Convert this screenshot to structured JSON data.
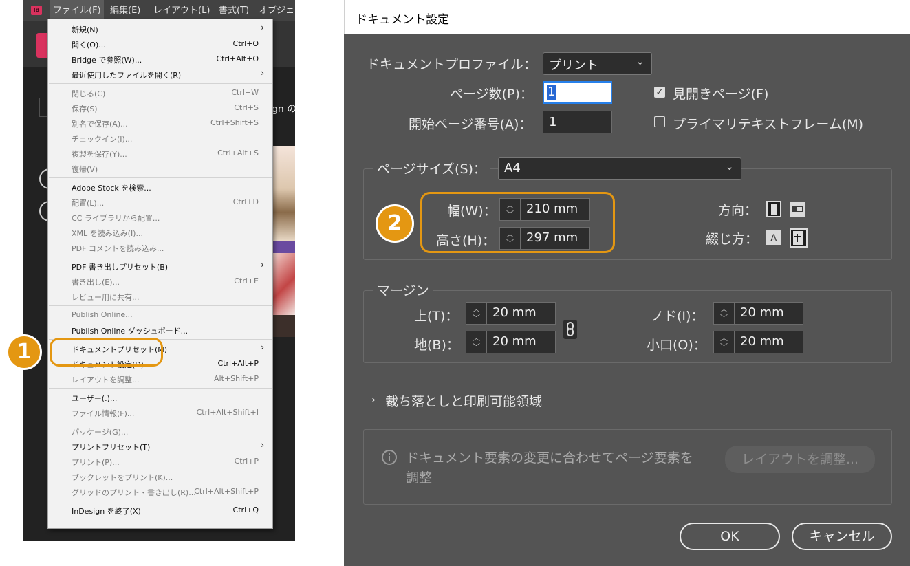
{
  "app": {
    "logo_text": "Id",
    "menubar": [
      "ファイル(F)",
      "編集(E)",
      "レイアウト(L)",
      "書式(T)",
      "オブジェ"
    ],
    "partial_text": "gn の"
  },
  "file_menu": {
    "items": [
      {
        "label": "新規(N)",
        "shortcut": "",
        "submenu": true,
        "disabled": false
      },
      {
        "label": "開く(O)...",
        "shortcut": "Ctrl+O",
        "submenu": false,
        "disabled": false
      },
      {
        "label": "Bridge で参照(W)...",
        "shortcut": "Ctrl+Alt+O",
        "submenu": false,
        "disabled": false
      },
      {
        "label": "最近使用したファイルを開く(R)",
        "shortcut": "",
        "submenu": true,
        "disabled": false
      },
      {
        "label": "閉じる(C)",
        "shortcut": "Ctrl+W",
        "submenu": false,
        "disabled": true
      },
      {
        "label": "保存(S)",
        "shortcut": "Ctrl+S",
        "submenu": false,
        "disabled": true
      },
      {
        "label": "別名で保存(A)...",
        "shortcut": "Ctrl+Shift+S",
        "submenu": false,
        "disabled": true
      },
      {
        "label": "チェックイン(I)...",
        "shortcut": "",
        "submenu": false,
        "disabled": true
      },
      {
        "label": "複製を保存(Y)...",
        "shortcut": "Ctrl+Alt+S",
        "submenu": false,
        "disabled": true
      },
      {
        "label": "復帰(V)",
        "shortcut": "",
        "submenu": false,
        "disabled": true
      },
      {
        "label": "Adobe Stock を検索...",
        "shortcut": "",
        "submenu": false,
        "disabled": false
      },
      {
        "label": "配置(L)...",
        "shortcut": "Ctrl+D",
        "submenu": false,
        "disabled": true
      },
      {
        "label": "CC ライブラリから配置...",
        "shortcut": "",
        "submenu": false,
        "disabled": true
      },
      {
        "label": "XML を読み込み(I)...",
        "shortcut": "",
        "submenu": false,
        "disabled": true
      },
      {
        "label": "PDF コメントを読み込み...",
        "shortcut": "",
        "submenu": false,
        "disabled": true
      },
      {
        "label": "PDF 書き出しプリセット(B)",
        "shortcut": "",
        "submenu": true,
        "disabled": false
      },
      {
        "label": "書き出し(E)...",
        "shortcut": "Ctrl+E",
        "submenu": false,
        "disabled": true
      },
      {
        "label": "レビュー用に共有...",
        "shortcut": "",
        "submenu": false,
        "disabled": true
      },
      {
        "label": "Publish Online...",
        "shortcut": "",
        "submenu": false,
        "disabled": true
      },
      {
        "label": "Publish Online ダッシュボード...",
        "shortcut": "",
        "submenu": false,
        "disabled": false
      },
      {
        "label": "ドキュメントプリセット(M)",
        "shortcut": "",
        "submenu": true,
        "disabled": false
      },
      {
        "label": "ドキュメント設定(D)...",
        "shortcut": "Ctrl+Alt+P",
        "submenu": false,
        "disabled": false
      },
      {
        "label": "レイアウトを調整...",
        "shortcut": "Alt+Shift+P",
        "submenu": false,
        "disabled": true
      },
      {
        "label": "ユーザー(.)...",
        "shortcut": "",
        "submenu": false,
        "disabled": false
      },
      {
        "label": "ファイル情報(F)...",
        "shortcut": "Ctrl+Alt+Shift+I",
        "submenu": false,
        "disabled": true
      },
      {
        "label": "パッケージ(G)...",
        "shortcut": "",
        "submenu": false,
        "disabled": true
      },
      {
        "label": "プリントプリセット(T)",
        "shortcut": "",
        "submenu": true,
        "disabled": false
      },
      {
        "label": "プリント(P)...",
        "shortcut": "Ctrl+P",
        "submenu": false,
        "disabled": true
      },
      {
        "label": "ブックレットをプリント(K)...",
        "shortcut": "",
        "submenu": false,
        "disabled": true
      },
      {
        "label": "グリッドのプリント・書き出し(R)...",
        "shortcut": "Ctrl+Alt+Shift+P",
        "submenu": false,
        "disabled": true
      },
      {
        "label": "InDesign を終了(X)",
        "shortcut": "Ctrl+Q",
        "submenu": false,
        "disabled": false
      }
    ]
  },
  "callouts": {
    "one": "1",
    "two": "2"
  },
  "dialog": {
    "title": "ドキュメント設定",
    "profile_label": "ドキュメントプロファイル：",
    "profile_value": "プリント",
    "pages_label": "ページ数(P)：",
    "pages_value": "1",
    "start_label": "開始ページ番号(A)：",
    "start_value": "1",
    "facing_label": "見開きページ(F)",
    "facing_checked": true,
    "primary_label": "プライマリテキストフレーム(M)",
    "primary_checked": false,
    "pagesize_label": "ページサイズ(S)：",
    "pagesize_value": "A4",
    "width_label": "幅(W)：",
    "width_value": "210 mm",
    "height_label": "高さ(H)：",
    "height_value": "297 mm",
    "orientation_label": "方向：",
    "binding_label": "綴じ方：",
    "margins_legend": "マージン",
    "top_label": "上(T)：",
    "top_value": "20 mm",
    "bottom_label": "地(B)：",
    "bottom_value": "20 mm",
    "inside_label": "ノド(I)：",
    "inside_value": "20 mm",
    "outside_label": "小口(O)：",
    "outside_value": "20 mm",
    "bleed_label": "裁ち落としと印刷可能領域",
    "info_text_1": "ドキュメント要素の変更に合わせてページ要素を",
    "info_text_2": "調整",
    "adjust_button": "レイアウトを調整...",
    "ok_button": "OK",
    "cancel_button": "キャンセル"
  }
}
